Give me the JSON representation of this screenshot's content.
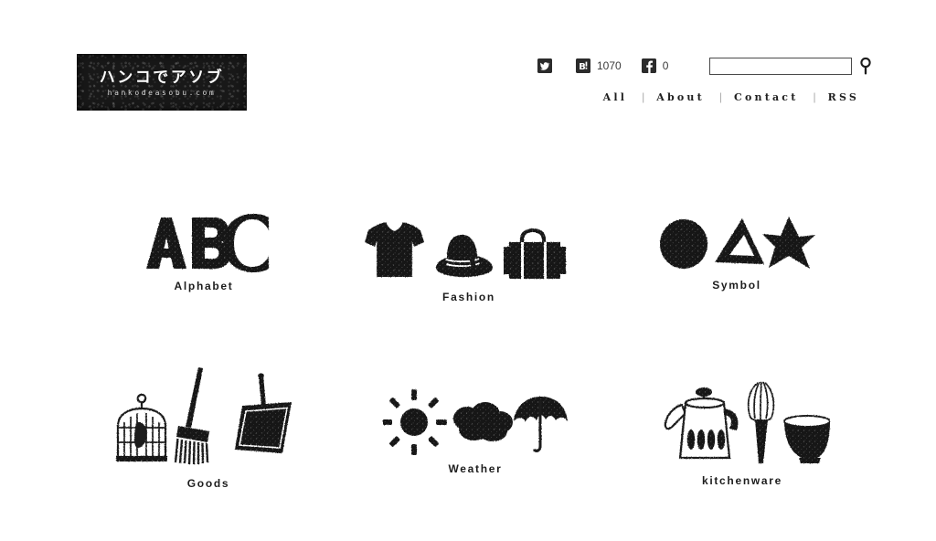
{
  "site": {
    "logo_jp": "ハンコでアソブ",
    "logo_domain": "hankodeasobu.com"
  },
  "header": {
    "social": [
      {
        "name": "twitter-icon",
        "glyph": "t",
        "count": null
      },
      {
        "name": "hatena-bookmark-icon",
        "glyph": "B!",
        "count": "1070"
      },
      {
        "name": "facebook-icon",
        "glyph": "f",
        "count": "0"
      }
    ],
    "search": {
      "value": "",
      "placeholder": "",
      "button_icon": "search-icon"
    },
    "nav": [
      {
        "label": "All"
      },
      {
        "label": "About"
      },
      {
        "label": "Contact"
      },
      {
        "label": "RSS"
      }
    ],
    "nav_separator": "|"
  },
  "categories": [
    {
      "id": "alphabet",
      "label": "Alphabet",
      "art": "abc-letters-stamp",
      "items": [
        "letter-a",
        "letter-b",
        "letter-c"
      ]
    },
    {
      "id": "fashion",
      "label": "Fashion",
      "art": "fashion-stamp",
      "items": [
        "tshirt-icon",
        "hat-icon",
        "suitcase-icon"
      ]
    },
    {
      "id": "symbol",
      "label": "Symbol",
      "art": "symbol-stamp",
      "items": [
        "circle-icon",
        "triangle-icon",
        "star-icon"
      ]
    },
    {
      "id": "goods",
      "label": "Goods",
      "art": "goods-stamp",
      "items": [
        "birdcage-icon",
        "broom-icon",
        "dustpan-icon"
      ]
    },
    {
      "id": "weather",
      "label": "Weather",
      "art": "weather-stamp",
      "items": [
        "sun-icon",
        "cloud-icon",
        "umbrella-icon"
      ]
    },
    {
      "id": "kitchenware",
      "label": "kitchenware",
      "art": "kitchenware-stamp",
      "items": [
        "kettle-icon",
        "whisk-icon",
        "bowl-icon"
      ]
    }
  ],
  "colors": {
    "background": "#ffffff",
    "ink": "#1d1d1d",
    "logo_bg": "#181818",
    "logo_text": "#ffffff",
    "muted": "#aaaaaa"
  }
}
